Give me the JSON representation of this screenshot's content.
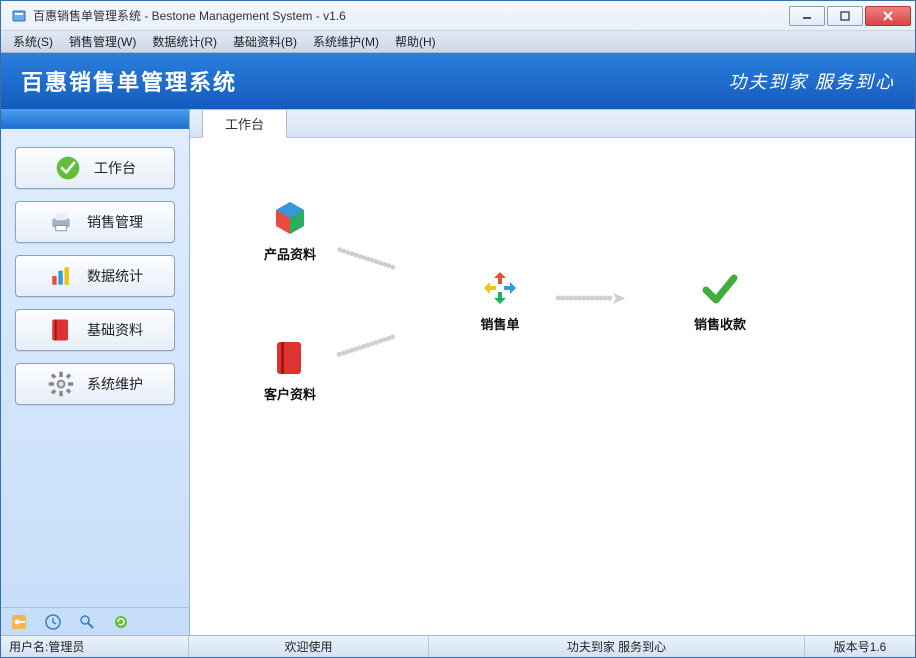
{
  "window": {
    "title": "百惠销售单管理系统 - Bestone Management System - v1.6"
  },
  "menubar": [
    "系统(S)",
    "销售管理(W)",
    "数据统计(R)",
    "基础资料(B)",
    "系统维护(M)",
    "帮助(H)"
  ],
  "banner": {
    "title": "百惠销售单管理系统",
    "slogan": "功夫到家 服务到心"
  },
  "sidebar": {
    "items": [
      {
        "label": "工作台"
      },
      {
        "label": "销售管理"
      },
      {
        "label": "数据统计"
      },
      {
        "label": "基础资料"
      },
      {
        "label": "系统维护"
      }
    ]
  },
  "tabs": {
    "active": "工作台"
  },
  "workspace": {
    "product": "产品资料",
    "customer": "客户资料",
    "order": "销售单",
    "receipt": "销售收款"
  },
  "status": {
    "user_label": "用户名:管理员",
    "welcome": "欢迎使用",
    "slogan": "功夫到家 服务到心",
    "version": "版本号1.6"
  }
}
